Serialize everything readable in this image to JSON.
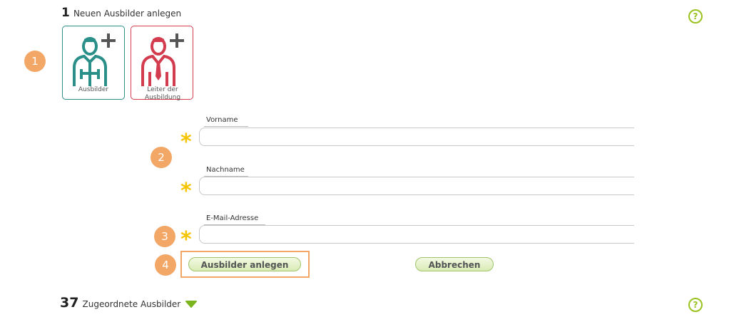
{
  "section1": {
    "number": "1",
    "title": "Neuen Ausbilder anlegen",
    "help": "?"
  },
  "cards": [
    {
      "label": "Ausbilder",
      "icon": "add-trainer-icon",
      "color": "#2a8f88"
    },
    {
      "label": "Leiter der Ausbildung",
      "icon": "add-training-manager-icon",
      "color": "#d33c4f"
    }
  ],
  "badges": [
    "1",
    "2",
    "3",
    "4"
  ],
  "form": {
    "firstname_label": "Vorname",
    "lastname_label": "Nachname",
    "email_label": "E-Mail-Adresse",
    "required_marker": "*",
    "firstname_value": "",
    "lastname_value": "",
    "email_value": ""
  },
  "buttons": {
    "create": "Ausbilder anlegen",
    "cancel": "Abbrechen"
  },
  "section2": {
    "number": "37",
    "title": "Zugeordnete Ausbilder",
    "help": "?"
  },
  "colors": {
    "accent_green": "#9ac21f",
    "badge_orange": "#f2a766",
    "required_yellow": "#f5c400"
  }
}
